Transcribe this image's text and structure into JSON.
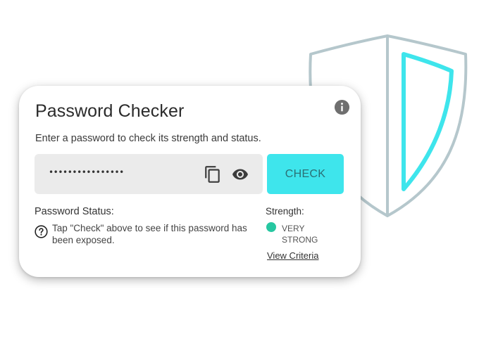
{
  "card": {
    "title": "Password Checker",
    "subtitle": "Enter a password to check its strength and status.",
    "info_icon": "info-icon"
  },
  "password": {
    "value": "••••••••••••••••",
    "copy_icon": "copy-icon",
    "visibility_icon": "eye-icon"
  },
  "check_button": {
    "label": "CHECK"
  },
  "status": {
    "label": "Password Status:",
    "help_icon": "question-circle-icon",
    "text": "Tap \"Check\" above to see if this password has been exposed."
  },
  "strength": {
    "label": "Strength:",
    "value": "VERY STRONG",
    "indicator_color": "#26c7a1",
    "link": "View Criteria"
  },
  "colors": {
    "accent": "#3ee5ec",
    "shield_outline": "#b5c7cc",
    "shield_inner": "#3ee5ec"
  }
}
